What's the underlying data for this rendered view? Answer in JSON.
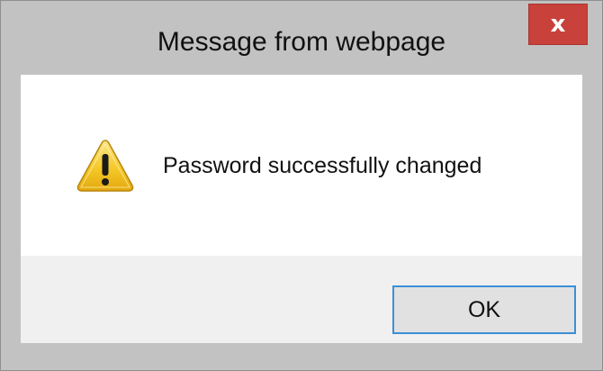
{
  "window": {
    "title": "Message from webpage",
    "close_label": "x"
  },
  "dialog": {
    "icon": "warning-icon",
    "message": "Password successfully changed",
    "ok_label": "OK"
  },
  "colors": {
    "frame": "#c2c2c2",
    "close_button": "#c9413b",
    "ok_border": "#3c8fd6",
    "warning_yellow": "#f2c21a"
  }
}
